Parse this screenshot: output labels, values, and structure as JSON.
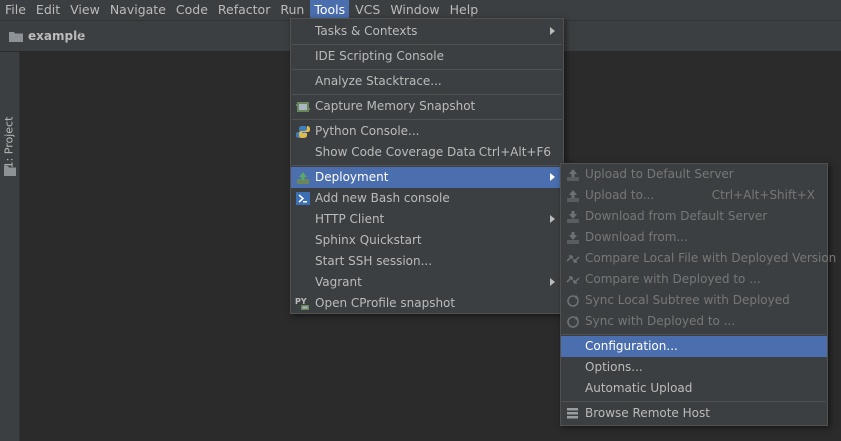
{
  "menubar": {
    "items": [
      "File",
      "Edit",
      "View",
      "Navigate",
      "Code",
      "Refactor",
      "Run",
      "Tools",
      "VCS",
      "Window",
      "Help"
    ],
    "active": "Tools"
  },
  "navbar": {
    "breadcrumb": "example"
  },
  "toolstrip": {
    "project_tab": "1: Project"
  },
  "tools_menu": {
    "tasks_contexts": "Tasks & Contexts",
    "ide_scripting_console": "IDE Scripting Console",
    "analyze_stacktrace": "Analyze Stacktrace...",
    "capture_memory_snapshot": "Capture Memory Snapshot",
    "python_console": "Python Console...",
    "show_code_coverage": "Show Code Coverage Data",
    "show_code_coverage_shortcut": "Ctrl+Alt+F6",
    "deployment": "Deployment",
    "add_bash_console": "Add new Bash console",
    "http_client": "HTTP Client",
    "sphinx_quickstart": "Sphinx Quickstart",
    "start_ssh": "Start SSH session...",
    "vagrant": "Vagrant",
    "open_cprofile": "Open CProfile snapshot"
  },
  "deployment_menu": {
    "upload_default": "Upload to Default Server",
    "upload_to": "Upload to...",
    "upload_to_shortcut": "Ctrl+Alt+Shift+X",
    "download_default": "Download from Default Server",
    "download_from": "Download from...",
    "compare_local": "Compare Local File with Deployed Version",
    "compare_deployed": "Compare with Deployed to ...",
    "sync_local_subtree": "Sync Local Subtree with Deployed",
    "sync_deployed": "Sync with Deployed to ...",
    "configuration": "Configuration...",
    "options": "Options...",
    "automatic_upload": "Automatic Upload",
    "browse_remote_host": "Browse Remote Host"
  },
  "colors": {
    "background": "#2b2b2b",
    "chrome": "#3c3f41",
    "highlight": "#4b6eaf",
    "text": "#bbbbbb",
    "disabled_text": "#777777"
  }
}
